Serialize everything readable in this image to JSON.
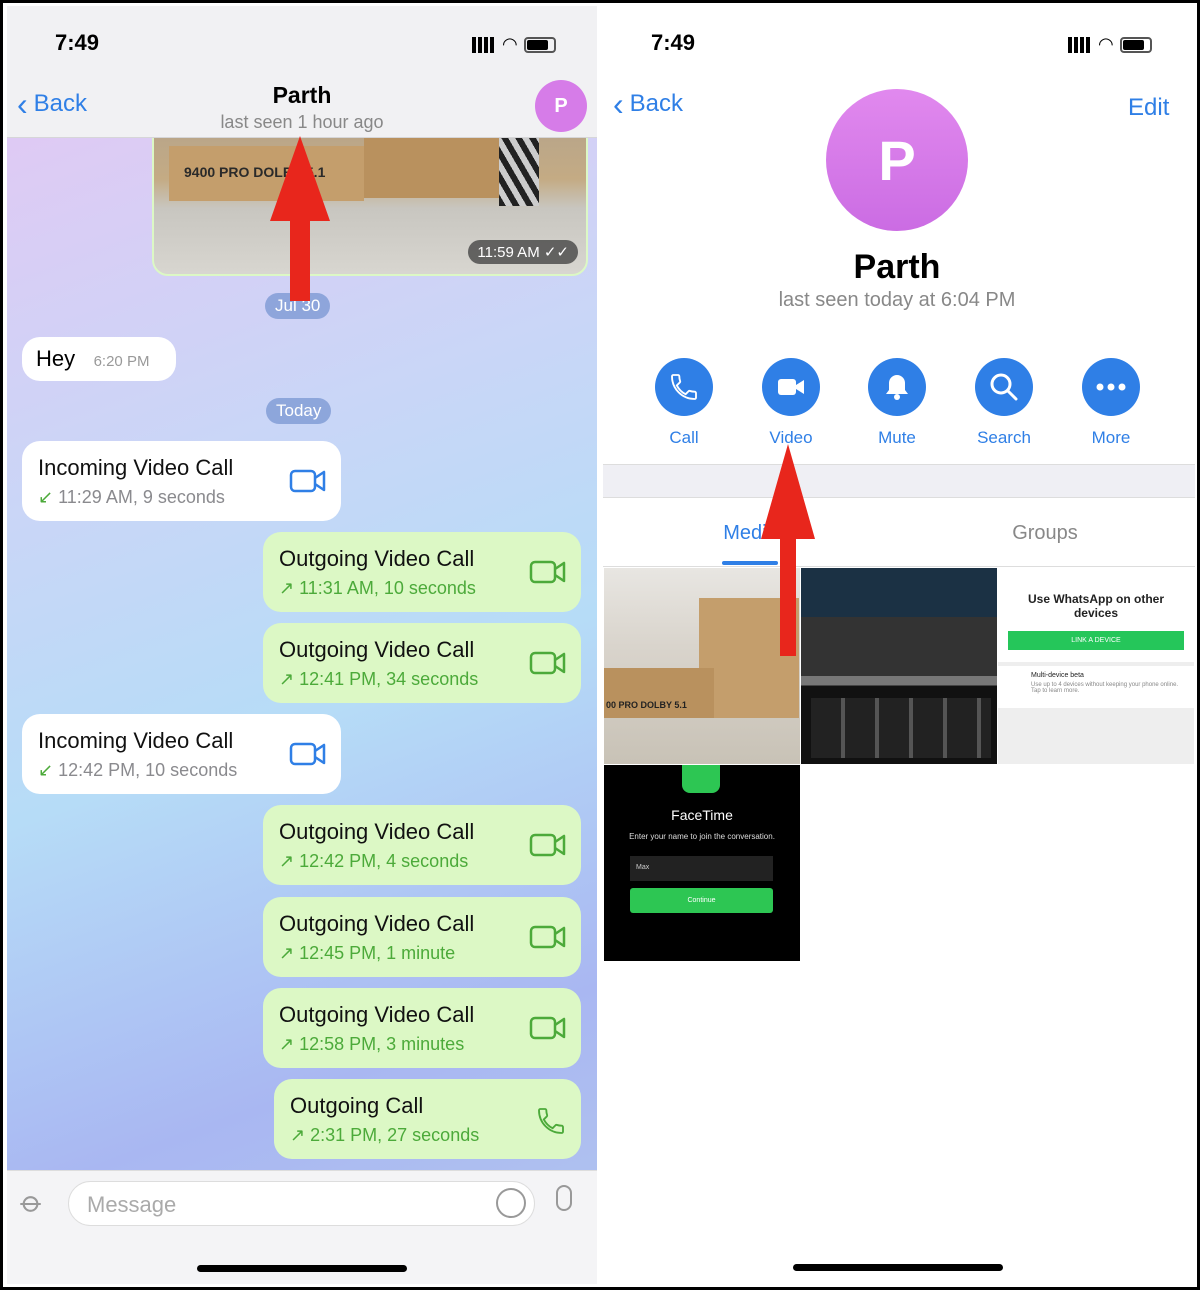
{
  "left": {
    "status_time": "7:49",
    "header": {
      "back_label": "Back",
      "title": "Parth",
      "subtitle": "last seen 1 hour ago",
      "avatar_letter": "P"
    },
    "photo_message": {
      "time": "11:59 AM",
      "box_text": "9400 PRO DOLBY 5.1"
    },
    "date_pills": [
      "Jul 30",
      "Today"
    ],
    "hey_message": {
      "text": "Hey",
      "time": "6:20 PM"
    },
    "calls": [
      {
        "dir": "in",
        "title": "Incoming Video Call",
        "detail": "11:29 AM, 9 seconds",
        "icon": "video-camera-icon"
      },
      {
        "dir": "out",
        "title": "Outgoing Video Call",
        "detail": "11:31 AM, 10 seconds",
        "icon": "video-camera-icon"
      },
      {
        "dir": "out",
        "title": "Outgoing Video Call",
        "detail": "12:41 PM, 34 seconds",
        "icon": "video-camera-icon"
      },
      {
        "dir": "in",
        "title": "Incoming Video Call",
        "detail": "12:42 PM, 10 seconds",
        "icon": "video-camera-icon"
      },
      {
        "dir": "out",
        "title": "Outgoing Video Call",
        "detail": "12:42 PM, 4 seconds",
        "icon": "video-camera-icon"
      },
      {
        "dir": "out",
        "title": "Outgoing Video Call",
        "detail": "12:45 PM, 1 minute",
        "icon": "video-camera-icon"
      },
      {
        "dir": "out",
        "title": "Outgoing Video Call",
        "detail": "12:58 PM, 3 minutes",
        "icon": "video-camera-icon"
      },
      {
        "dir": "out",
        "title": "Outgoing Call",
        "detail": "2:31 PM, 27 seconds",
        "icon": "phone-icon"
      }
    ],
    "composer": {
      "placeholder": "Message"
    }
  },
  "right": {
    "status_time": "7:49",
    "back_label": "Back",
    "edit_label": "Edit",
    "avatar_letter": "P",
    "name": "Parth",
    "last_seen": "last seen today at 6:04 PM",
    "actions": [
      {
        "label": "Call",
        "icon": "phone-icon"
      },
      {
        "label": "Video",
        "icon": "video-camera-icon"
      },
      {
        "label": "Mute",
        "icon": "bell-icon"
      },
      {
        "label": "Search",
        "icon": "search-icon"
      },
      {
        "label": "More",
        "icon": "more-icon"
      }
    ],
    "tabs": [
      {
        "label": "Media",
        "active": true
      },
      {
        "label": "Groups",
        "active": false
      }
    ],
    "media": {
      "whatsapp": {
        "title": "Use WhatsApp on other devices",
        "button": "LINK A DEVICE",
        "beta_title": "Multi-device beta",
        "beta_text": "Use up to 4 devices without keeping your phone online. Tap to learn more."
      },
      "facetime": {
        "title": "FaceTime",
        "prompt": "Enter your name to join the conversation.",
        "name_value": "Max",
        "button": "Continue"
      },
      "box_text": "00 PRO DOLBY 5.1"
    }
  },
  "colors": {
    "accent": "#2f7fe6",
    "avatar": "#d67ce8",
    "outgoing_bubble": "#dcf8c5",
    "annotation_arrow": "#e8261c"
  }
}
